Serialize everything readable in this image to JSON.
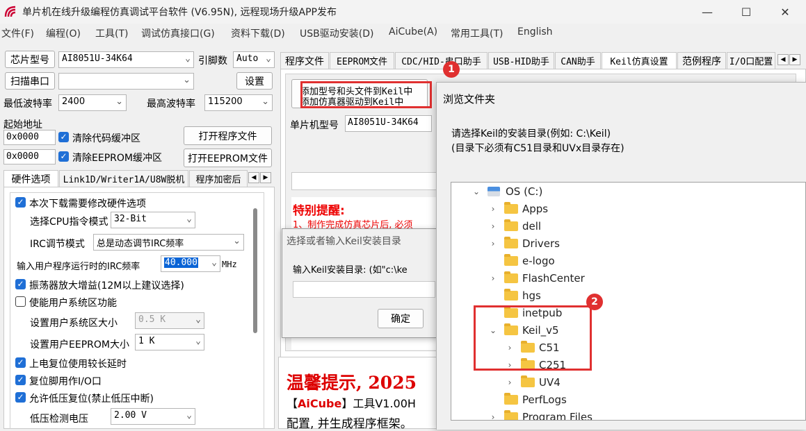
{
  "window": {
    "title": "单片机在线升级编程仿真调试平台软件 (V6.95N), 远程现场升级APP发布",
    "minimize_glyph": "—",
    "maximize_glyph": "☐",
    "close_glyph": "✕"
  },
  "menu": [
    "文件(F)",
    "编程(O)",
    "工具(T)",
    "调试仿真接口(G)",
    "资料下载(D)",
    "USB驱动安装(D)",
    "AiCube(A)",
    "常用工具(T)",
    "English"
  ],
  "left": {
    "chip_btn": "芯片型号",
    "chip_value": "AI8051U-34K64",
    "pin_label": "引脚数",
    "pin_value": "Auto",
    "scan_btn": "扫描串口",
    "port_value": "",
    "settings_btn": "设置",
    "min_baud_label": "最低波特率",
    "min_baud_value": "2400",
    "max_baud_label": "最高波特率",
    "max_baud_value": "115200",
    "start_addr_label": "起始地址",
    "addr1": "0x0000",
    "addr2": "0x0000",
    "clear_code": "清除代码缓冲区",
    "clear_eeprom": "清除EEPROM缓冲区",
    "open_prog_btn": "打开程序文件",
    "open_eeprom_btn": "打开EEPROM文件",
    "tabs": [
      "硬件选项",
      "Link1D/Writer1A/U8W脱机",
      "程序加密后"
    ],
    "hw": {
      "modify_hw": "本次下载需要修改硬件选项",
      "cpu_mode_label": "选择CPU指令模式",
      "cpu_mode_value": "32-Bit",
      "irc_mode_label": "IRC调节模式",
      "irc_mode_value": "总是动态调节IRC频率",
      "irc_freq_label": "输入用户程序运行时的IRC频率",
      "irc_freq_value": "40.000",
      "irc_unit": "MHz",
      "osc_gain": "振荡器放大增益(12M以上建议选择)",
      "user_sys": "使能用户系统区功能",
      "user_sys_size_label": "设置用户系统区大小",
      "user_sys_size_value": "0.5 K",
      "user_eeprom_label": "设置用户EEPROM大小",
      "user_eeprom_value": "1   K",
      "long_delay": "上电复位使用较长延时",
      "reset_io": "复位脚用作I/O口",
      "low_volt_reset": "允许低压复位(禁止低压中断)",
      "low_volt_label": "低压检测电压",
      "low_volt_value": "2.00 V"
    }
  },
  "right": {
    "tabs": [
      "程序文件",
      "EEPROM文件",
      "CDC/HID-串口助手",
      "USB-HID助手",
      "CAN助手",
      "Keil仿真设置",
      "范例程序",
      "I/O口配置"
    ],
    "keil": {
      "add_model_btn_l1": "添加型号和头文件到Keil中",
      "add_model_btn_l2": "添加仿真器驱动到Keil中",
      "mcu_model_label": "单片机型号",
      "mcu_model_value": "AI8051U-34K64",
      "warning_title": "特别提醒:",
      "warning_text": "1、制作完成仿真芯片后, 必须"
    },
    "keil_dialog": {
      "title": "选择或者输入Keil安装目录",
      "prompt": "输入Keil安装目录: (如\"c:\\ke",
      "ok_btn": "确定"
    },
    "tips": {
      "title": "温馨提示, 2025",
      "line1_prefix": "【",
      "line1_brand": "AiCube",
      "line1_suffix": "】工具V1.00H",
      "line2": "配置, 并生成程序框架。"
    }
  },
  "browse": {
    "title": "浏览文件夹",
    "desc1": "请选择Keil的安装目录(例如: C:\\Keil)",
    "desc2": "(目录下必须有C51目录和UVx目录存在)",
    "tree": [
      {
        "label": "OS (C:)",
        "level": 0,
        "chevron": "⌄",
        "icon": "drive"
      },
      {
        "label": "Apps",
        "level": 1,
        "chevron": "›",
        "icon": "folder"
      },
      {
        "label": "dell",
        "level": 1,
        "chevron": "›",
        "icon": "folder"
      },
      {
        "label": "Drivers",
        "level": 1,
        "chevron": "›",
        "icon": "folder"
      },
      {
        "label": "e-logo",
        "level": 1,
        "chevron": "",
        "icon": "folder"
      },
      {
        "label": "FlashCenter",
        "level": 1,
        "chevron": "›",
        "icon": "folder"
      },
      {
        "label": "hgs",
        "level": 1,
        "chevron": "",
        "icon": "folder"
      },
      {
        "label": "inetpub",
        "level": 1,
        "chevron": "",
        "icon": "folder"
      },
      {
        "label": "Keil_v5",
        "level": 1,
        "chevron": "⌄",
        "icon": "folder"
      },
      {
        "label": "C51",
        "level": 2,
        "chevron": "›",
        "icon": "folder"
      },
      {
        "label": "C251",
        "level": 2,
        "chevron": "›",
        "icon": "folder"
      },
      {
        "label": "UV4",
        "level": 2,
        "chevron": "›",
        "icon": "folder"
      },
      {
        "label": "PerfLogs",
        "level": 1,
        "chevron": "",
        "icon": "folder"
      },
      {
        "label": "Program Files",
        "level": 1,
        "chevron": "›",
        "icon": "folder"
      }
    ]
  },
  "annotations": {
    "badge1": "1",
    "badge2": "2",
    "accent": "#e03030"
  }
}
